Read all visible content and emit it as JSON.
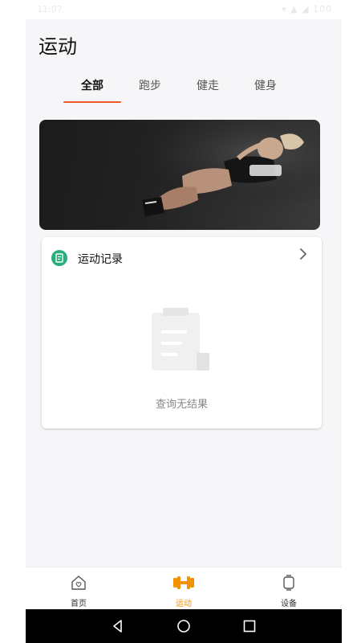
{
  "status_bar": {
    "time": "11:07",
    "right": "▾ ▲ ◢ 100"
  },
  "header": {
    "title": "运动"
  },
  "tabs": [
    {
      "label": "全部",
      "active": true
    },
    {
      "label": "跑步",
      "active": false
    },
    {
      "label": "健走",
      "active": false
    },
    {
      "label": "健身",
      "active": false
    }
  ],
  "record_card": {
    "title": "运动记录",
    "empty_text": "查询无结果"
  },
  "bottom_nav": [
    {
      "label": "首页",
      "icon": "home-icon",
      "active": false
    },
    {
      "label": "运动",
      "icon": "dumbbell-icon",
      "active": true
    },
    {
      "label": "设备",
      "icon": "watch-icon",
      "active": false
    }
  ],
  "colors": {
    "accent": "#f15a24",
    "nav_active": "#f39200",
    "record_icon": "#27ae7a"
  }
}
